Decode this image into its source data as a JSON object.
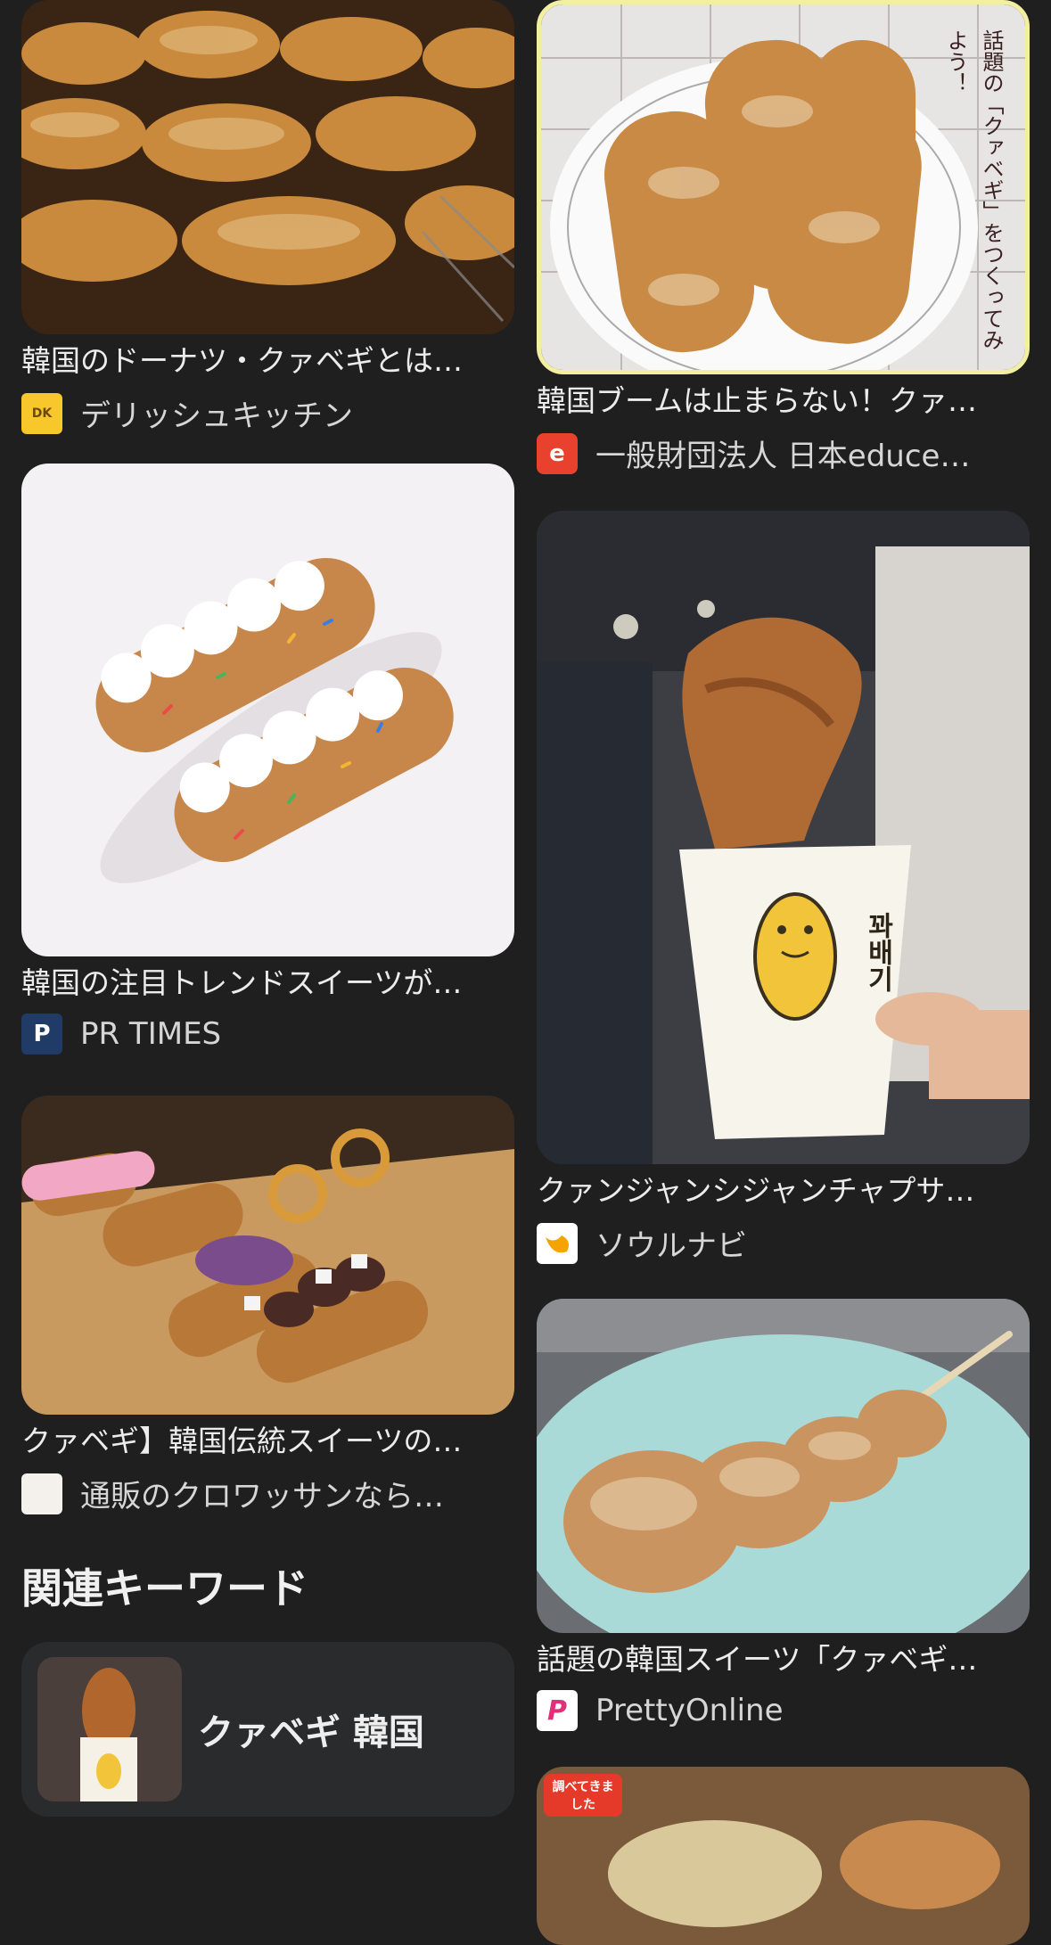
{
  "results": {
    "left": [
      {
        "title": "韓国のドーナツ・クァベギとは…",
        "source": "デリッシュキッチン",
        "favicon_glyph": "DK",
        "favicon_bg": "#f7c72c",
        "favicon_fg": "#6a4a10"
      },
      {
        "title": "韓国の注目トレンドスイーツが…",
        "source": "PR TIMES",
        "favicon_glyph": "P",
        "favicon_bg": "#1f3b66",
        "favicon_fg": "#ffffff"
      },
      {
        "title": "クァベギ】韓国伝統スイーツの…",
        "source": "通販のクロワッサンなら…",
        "favicon_glyph": "",
        "favicon_bg": "#f4f1ec",
        "favicon_fg": "#a08a70"
      }
    ],
    "right": [
      {
        "title": "韓国ブームは止まらない！クァ…",
        "source": "一般財団法人 日本educe…",
        "favicon_glyph": "e",
        "favicon_bg": "#e8422e",
        "favicon_fg": "#ffffff",
        "image_caption": "話題の「クァベギ」をつくってみよう！"
      },
      {
        "title": "クァンジャンシジャンチャプサ…",
        "source": "ソウルナビ",
        "favicon_glyph": "",
        "favicon_bg": "#ffffff",
        "favicon_fg": "#f5a300",
        "cup_text": "꽈배기"
      },
      {
        "title": "話題の韓国スイーツ「クァベギ…",
        "source": "PrettyOnline",
        "favicon_glyph": "P",
        "favicon_bg": "#ffffff",
        "favicon_fg": "#e0307a"
      },
      {
        "badge_text": "調べてきました"
      }
    ]
  },
  "related": {
    "heading": "関連キーワード",
    "keywords": [
      {
        "label": "クァベギ 韓国"
      }
    ]
  },
  "colors": {
    "background": "#1f1f1f",
    "chip": "#2a2b2d",
    "text": "#ececec"
  }
}
